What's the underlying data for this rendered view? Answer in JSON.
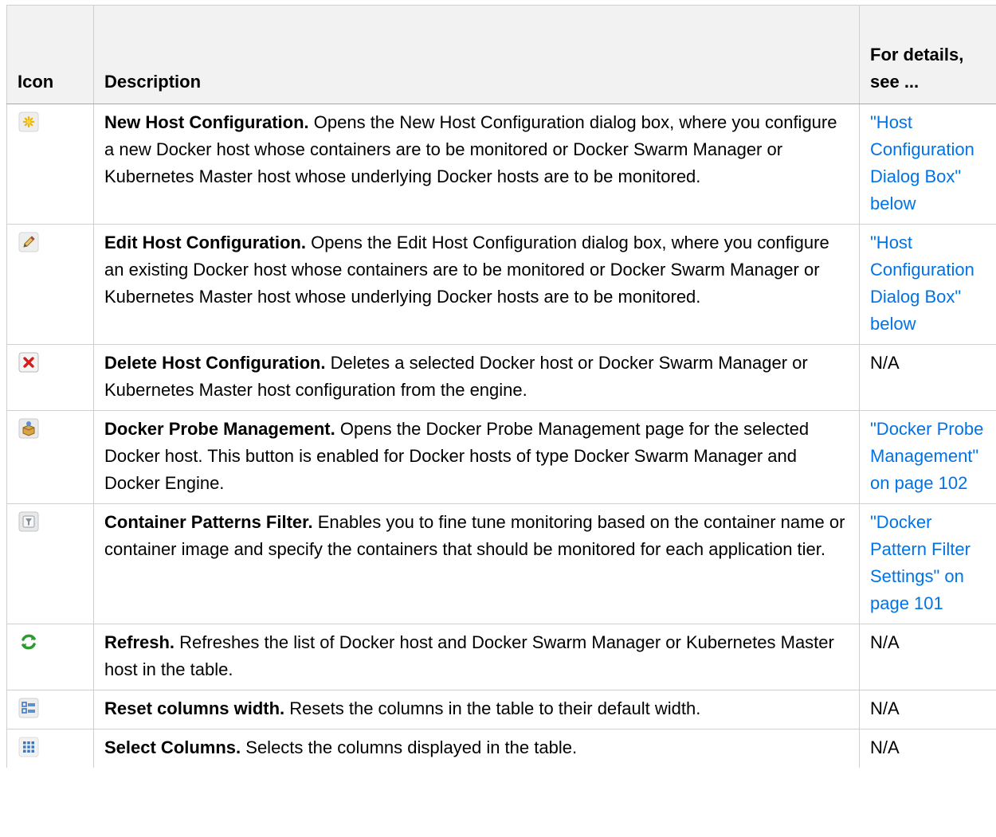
{
  "table": {
    "headers": {
      "icon": "Icon",
      "description": "Description",
      "details": "For details, see ..."
    },
    "rows": [
      {
        "icon": "new-host-star-icon",
        "title": "New Host Configuration.",
        "text": " Opens the New Host Configuration dialog box, where you configure a new Docker host whose containers are to be monitored or Docker Swarm Manager or Kubernetes Master host whose underlying Docker hosts are to be monitored.",
        "see": "\"Host Configuration Dialog Box\" below",
        "see_is_link": true
      },
      {
        "icon": "edit-pencil-icon",
        "title": "Edit Host Configuration.",
        "text": " Opens the Edit Host Configuration dialog box, where you configure an existing Docker host whose containers are to be monitored or Docker Swarm Manager or Kubernetes Master host whose underlying Docker hosts are to be monitored.",
        "see": "\"Host Configuration Dialog Box\" below",
        "see_is_link": true
      },
      {
        "icon": "delete-x-icon",
        "title": "Delete Host Configuration.",
        "text": " Deletes a selected Docker host or Docker Swarm Manager or Kubernetes Master host configuration from the engine.",
        "see": "N/A",
        "see_is_link": false
      },
      {
        "icon": "probe-box-icon",
        "title": "Docker Probe Management.",
        "text": " Opens the Docker Probe Management page for the selected Docker host. This button is enabled for Docker hosts of type Docker Swarm Manager and Docker Engine.",
        "see": "\"Docker Probe Management\" on page 102",
        "see_is_link": true
      },
      {
        "icon": "filter-icon",
        "title": "Container Patterns Filter.",
        "text": " Enables you to fine tune monitoring based on the container name or container image and specify the containers that should be monitored for each application tier.",
        "see": "\"Docker Pattern Filter Settings\" on page 101",
        "see_is_link": true
      },
      {
        "icon": "refresh-icon",
        "title": "Refresh.",
        "text": " Refreshes the list of Docker host and Docker Swarm Manager or Kubernetes Master host in the table.",
        "see": "N/A",
        "see_is_link": false
      },
      {
        "icon": "reset-columns-icon",
        "title": "Reset columns width.",
        "text": " Resets the columns in the table to their default width.",
        "see": "N/A",
        "see_is_link": false
      },
      {
        "icon": "select-columns-grid-icon",
        "title": "Select Columns.",
        "text": " Selects the columns displayed in the table.",
        "see": "N/A",
        "see_is_link": false
      }
    ]
  },
  "colors": {
    "link": "#0073e7",
    "header_bg": "#f2f2f2",
    "border": "#cfcfcf"
  }
}
